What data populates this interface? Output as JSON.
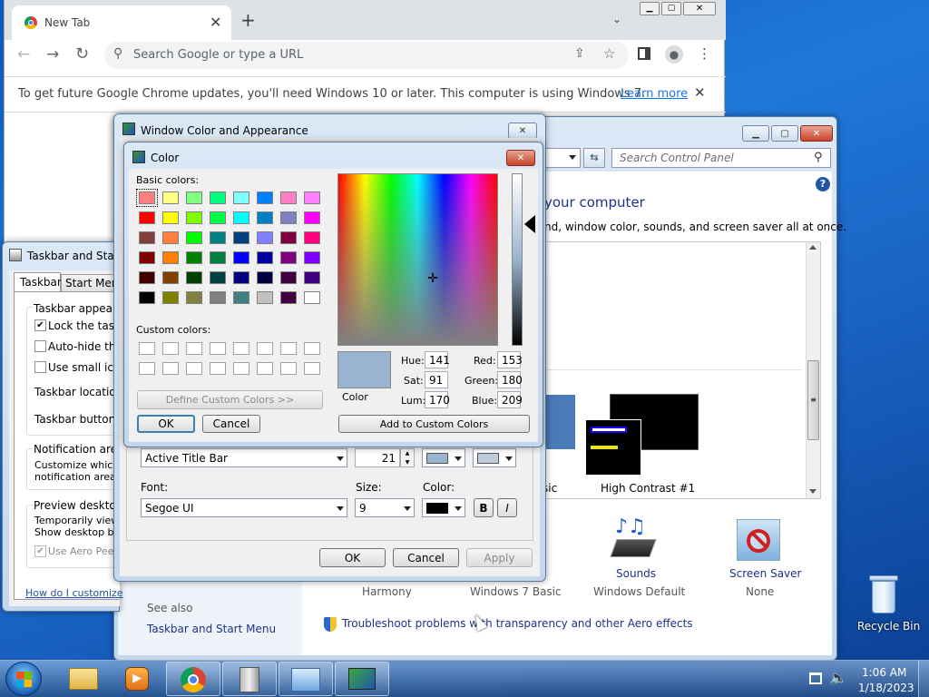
{
  "chrome": {
    "tab_title": "New Tab",
    "search_placeholder": "Search Google or type a URL",
    "update_msg": "To get future Google Chrome updates, you'll need Windows 10 or later. This computer is using Windows 7.",
    "learn_more": "Learn more"
  },
  "cp": {
    "search_placeholder": "Search Control Panel",
    "heading": "your computer",
    "subheading": "nd, window color, sounds, and screen saver all at once.",
    "basic_partial": "sic",
    "high_contrast": "High Contrast #1",
    "sounds": "Sounds",
    "screen_saver": "Screen Saver",
    "row": [
      "Harmony",
      "Windows 7 Basic",
      "Windows Default",
      "None"
    ],
    "see_also": "See also",
    "taskbar_link": "Taskbar and Start Menu",
    "troubleshoot": "Troubleshoot problems with transparency and other Aero effects"
  },
  "taskbar_dlg": {
    "title": "Taskbar and Start",
    "tabs": [
      "Taskbar",
      "Start Menu"
    ],
    "appearance": "Taskbar appearan",
    "lock": "Lock the taskba",
    "autohide": "Auto-hide the t",
    "small": "Use small icons",
    "location": "Taskbar location o",
    "buttons": "Taskbar buttons:",
    "notif": "Notification area",
    "notif_desc1": "Customize which ic",
    "notif_desc2": "notification area.",
    "preview": "Preview desktop w",
    "preview_desc1": "Temporarily view t",
    "preview_desc2": "Show desktop butt",
    "aero": "Use Aero Peek",
    "howto": "How do I customize"
  },
  "wca": {
    "title": "Window Color and Appearance",
    "item": "Active Title Bar",
    "size": "21",
    "font_label": "Font:",
    "font": "Segoe UI",
    "size_label": "Size:",
    "font_size": "9",
    "color_label": "Color:",
    "bold": "B",
    "italic": "I",
    "ok": "OK",
    "cancel": "Cancel",
    "apply": "Apply"
  },
  "color": {
    "title": "Color",
    "basic_label": "Basic colors:",
    "custom_label": "Custom colors:",
    "define": "Define Custom Colors >>",
    "ok": "OK",
    "cancel": "Cancel",
    "add": "Add to Custom Colors",
    "color_solid": "Color",
    "hue_label": "Hue:",
    "sat_label": "Sat:",
    "lum_label": "Lum:",
    "red_label": "Red:",
    "green_label": "Green:",
    "blue_label": "Blue:",
    "hue": "141",
    "sat": "91",
    "lum": "170",
    "red": "153",
    "green": "180",
    "blue": "209",
    "selected_color": "#99b4d1",
    "basic_colors": [
      "#ff8080",
      "#ffff80",
      "#80ff80",
      "#00ff80",
      "#80ffff",
      "#0080ff",
      "#ff80c0",
      "#ff80ff",
      "#ff0000",
      "#ffff00",
      "#80ff00",
      "#00ff40",
      "#00ffff",
      "#0080c0",
      "#8080c0",
      "#ff00ff",
      "#804040",
      "#ff8040",
      "#00ff00",
      "#008080",
      "#004080",
      "#8080ff",
      "#800040",
      "#ff0080",
      "#800000",
      "#ff8000",
      "#008000",
      "#008040",
      "#0000ff",
      "#0000a0",
      "#800080",
      "#8000ff",
      "#400000",
      "#804000",
      "#004000",
      "#004040",
      "#000080",
      "#000040",
      "#400040",
      "#400080",
      "#000000",
      "#808000",
      "#808040",
      "#808080",
      "#408080",
      "#c0c0c0",
      "#400040",
      "#ffffff"
    ]
  },
  "desktop": {
    "recycle": "Recycle Bin"
  },
  "taskbar": {
    "time": "1:06 AM",
    "date": "1/18/2023"
  }
}
